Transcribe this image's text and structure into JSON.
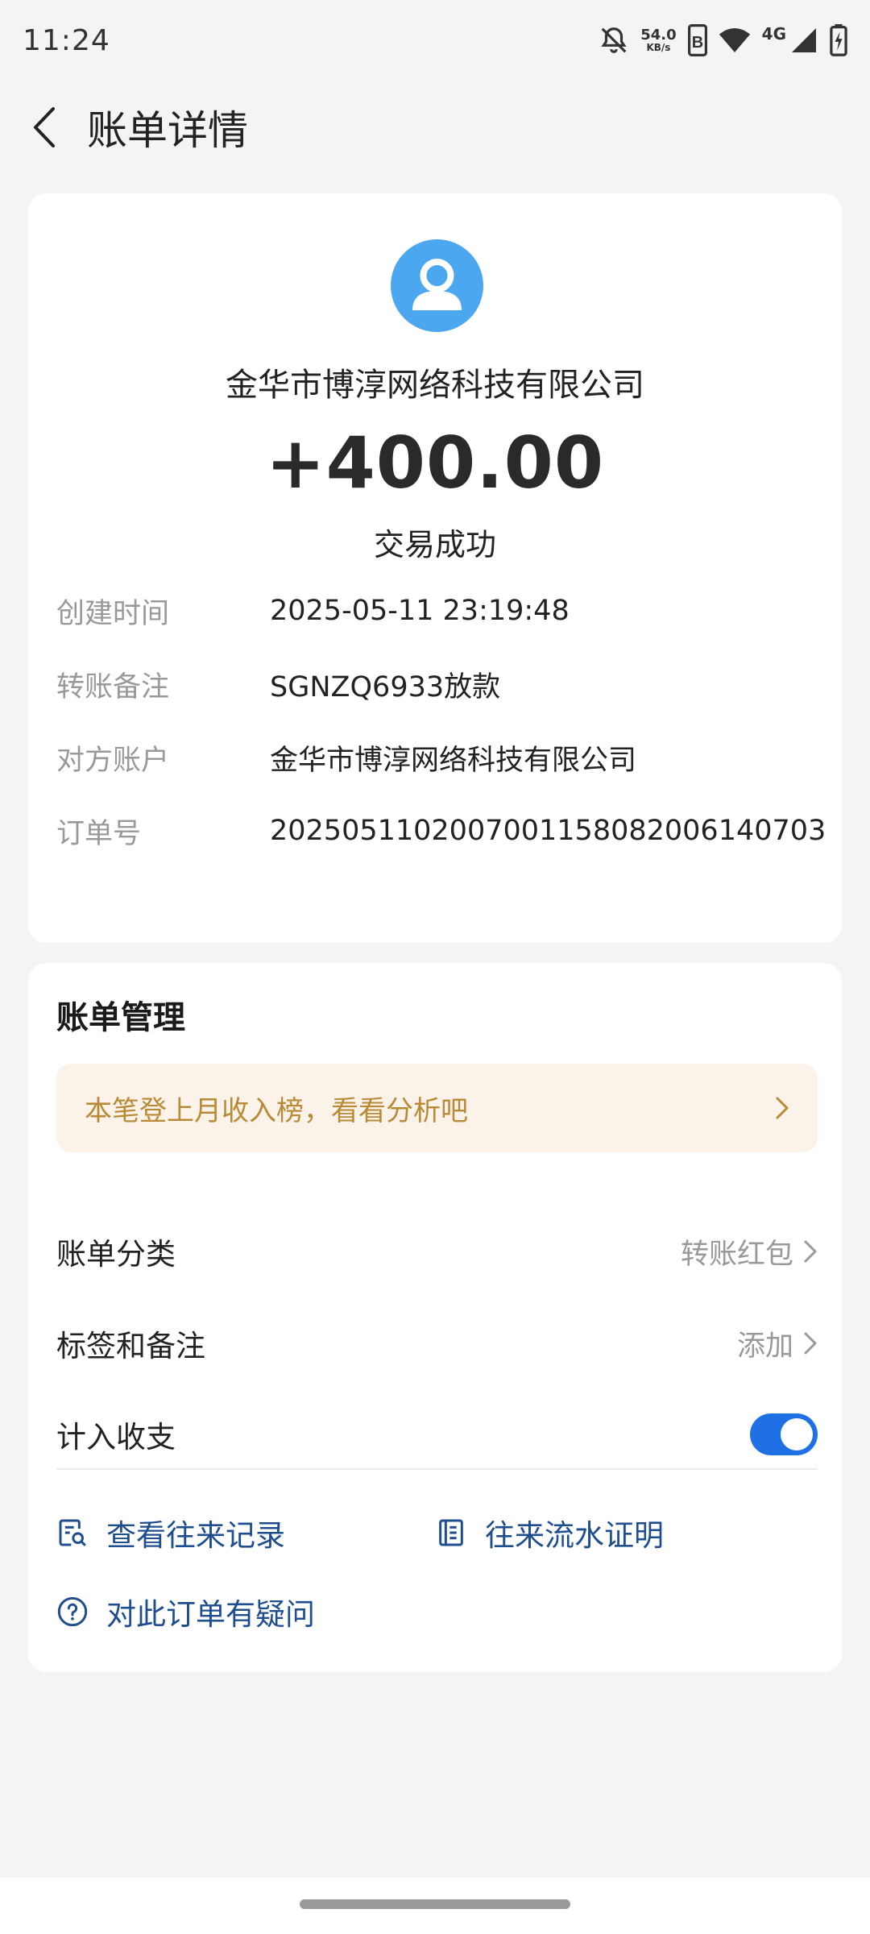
{
  "status_bar": {
    "time": "11:24",
    "net_speed_value": "54.0",
    "net_speed_unit": "KB/s",
    "network_type": "4G"
  },
  "nav": {
    "title": "账单详情"
  },
  "transaction": {
    "payee": "金华市博淳网络科技有限公司",
    "amount": "+400.00",
    "status": "交易成功",
    "details": [
      {
        "label": "创建时间",
        "value": "2025-05-11 23:19:48"
      },
      {
        "label": "转账备注",
        "value": "SGNZQ6933放款"
      },
      {
        "label": "对方账户",
        "value": "金华市博淳网络科技有限公司"
      },
      {
        "label": "订单号",
        "value": "2025051102007001158082006140703"
      }
    ]
  },
  "management": {
    "title": "账单管理",
    "tip": "本笔登上月收入榜，看看分析吧",
    "category_label": "账单分类",
    "category_value": "转账红包",
    "tags_label": "标签和备注",
    "tags_value": "添加",
    "include_label": "计入收支",
    "include_on": true,
    "link_records": "查看往来记录",
    "link_proof": "往来流水证明",
    "link_question": "对此订单有疑问"
  },
  "colors": {
    "accent_blue": "#1f70e4",
    "link_blue": "#1f4e8f",
    "avatar_blue": "#4aa7f0",
    "tip_text": "#b98a36",
    "tip_bg": "#fbf3ea"
  }
}
